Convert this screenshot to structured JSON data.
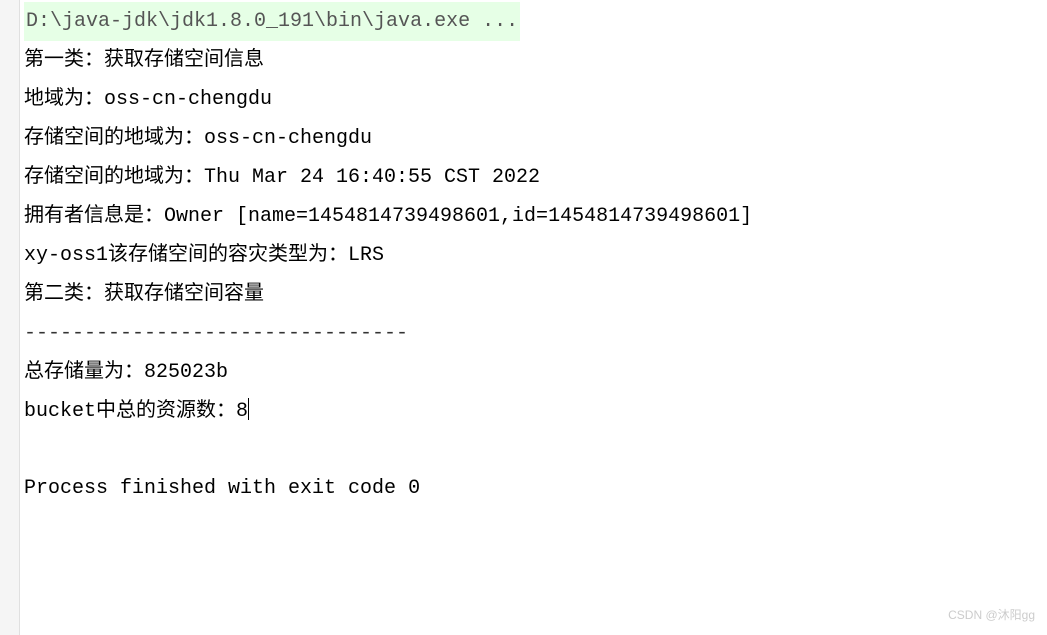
{
  "command_line": "D:\\java-jdk\\jdk1.8.0_191\\bin\\java.exe ...",
  "output": {
    "section1_title": "第一类：获取存储空间信息",
    "region_label": "地域为：",
    "region_value": "oss-cn-chengdu",
    "bucket_region_label": "存储空间的地域为：",
    "bucket_region_value": "oss-cn-chengdu",
    "bucket_region_label2": "存储空间的地域为：",
    "creation_date": "Thu Mar 24 16:40:55 CST 2022",
    "owner_label": "拥有者信息是：",
    "owner_value": "Owner [name=1454814739498601,id=1454814739498601]",
    "bucket_name": "xy-oss1",
    "redundancy_label": "该存储空间的容灾类型为：",
    "redundancy_value": "LRS",
    "section2_title": "第二类：获取存储空间容量",
    "separator": "--------------------------------",
    "storage_label": "总存储量为：",
    "storage_value": "825023b",
    "resource_label": "bucket中总的资源数：",
    "resource_count": "8"
  },
  "exit_message": "Process finished with exit code 0",
  "watermark": "CSDN @沐阳gg"
}
